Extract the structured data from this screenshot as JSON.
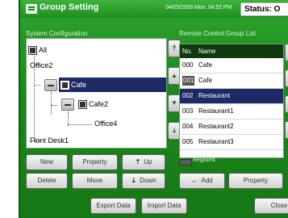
{
  "title": "Group Setting",
  "clock": "04/05/2009 Mon. 04:52 PM",
  "status_label": "Status: O",
  "system_config": {
    "label": "System Configuration",
    "tree": [
      "All",
      "Office2",
      "Cafe",
      "Cafe2",
      "Office4",
      "Flont Desk1"
    ]
  },
  "remote_list": {
    "label": "Remote Control Group List",
    "col_no": "No.",
    "col_name": "Name",
    "rows": [
      {
        "no": "000",
        "name": "Cafe"
      },
      {
        "no": "001",
        "name": "Cafe"
      },
      {
        "no": "002",
        "name": "Restaurant"
      },
      {
        "no": "003",
        "name": "Restaurant1"
      },
      {
        "no": "004",
        "name": "Restaurant2"
      },
      {
        "no": "005",
        "name": "Restaurant3"
      }
    ],
    "registered_label": "Registed"
  },
  "buttons": {
    "new": "New",
    "property": "Property",
    "up": "Up",
    "delete": "Delete",
    "move": "Move",
    "down": "Down",
    "add": "Add",
    "list_property": "Property",
    "export": "Export Data",
    "import": "Import Data",
    "close": "Close"
  },
  "colors": {
    "frame_green": "#1f8a1f",
    "selection_navy": "#1e2a66",
    "list_header": "#0f3a0f"
  }
}
